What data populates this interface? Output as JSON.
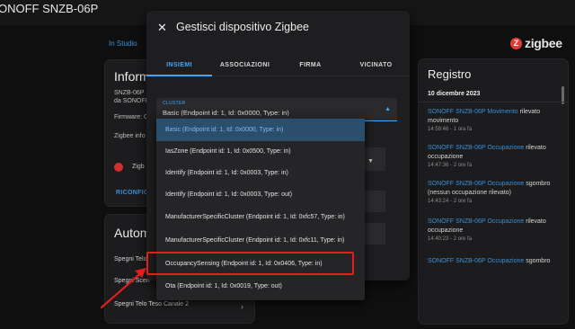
{
  "window": {
    "title": "ONOFF SNZB-06P"
  },
  "background": {
    "in_studio_link": "In Studio",
    "zigbee_logo": "zigbee",
    "info_card": {
      "heading": "Inform",
      "lines": [
        "SNZB-06P",
        "da SONOFF",
        "Firmware: C",
        "",
        "Zigbee info"
      ],
      "integration_label": "Zigb",
      "reconfigure_button": "RICONFIG"
    },
    "automation_card": {
      "heading": "Autom",
      "rows": [
        "Spegni Telo",
        "Spegni Sceri",
        "Spegni Telo Teso Canale 2"
      ]
    },
    "logbook_card": {
      "heading": "Registro",
      "date": "10 dicembre 2023",
      "entries": [
        {
          "link": "SONOFF SNZB-06P Movimento",
          "text": " rilevato movimento",
          "time": "14:59:46 - 1 ora fa"
        },
        {
          "link": "SONOFF SNZB-06P Occupazione",
          "text": " rilevato occupazione",
          "time": "14:47:36 - 2 ore fa"
        },
        {
          "link": "SONOFF SNZB-06P Occupazione",
          "text": " sgombro (nessun occupazione rilevato)",
          "time": "14:43:24 - 2 ore fa"
        },
        {
          "link": "SONOFF SNZB-06P Occupazione",
          "text": " rilevato occupazione",
          "time": "14:40:23 - 2 ore fa"
        },
        {
          "link": "SONOFF SNZB-06P Occupazione",
          "text": " sgombro",
          "time": ""
        }
      ]
    }
  },
  "dialog": {
    "title": "Gestisci dispositivo Zigbee",
    "close_icon": "close-icon",
    "tabs": [
      "INSIEMI",
      "ASSOCIAZIONI",
      "FIRMA",
      "VICINATO"
    ],
    "active_tab": 0,
    "cluster_select": {
      "label": "CLUSTER",
      "value": "Basic (Endpoint id: 1, Id: 0x0000, Type: in)"
    },
    "cluster_options": [
      "Basic (Endpoint id: 1, Id: 0x0000, Type: in)",
      "IasZone (Endpoint id: 1, Id: 0x0500, Type: in)",
      "Identify (Endpoint id: 1, Id: 0x0003, Type: in)",
      "Identify (Endpoint id: 1, Id: 0x0003, Type: out)",
      "ManufacturerSpecificCluster (Endpoint id: 1, Id: 0xfc57, Type: in)",
      "ManufacturerSpecificCluster (Endpoint id: 1, Id: 0xfc11, Type: in)",
      "OccupancySensing (Endpoint id: 1, Id: 0x0406, Type: in)",
      "Ota (Endpoint id: 1, Id: 0x0019, Type: out)"
    ],
    "selected_option": 0,
    "highlighted_option": 6
  },
  "colors": {
    "accent": "#42a5f5",
    "annotation": "#e01e1e",
    "link": "#3a8fd6"
  }
}
